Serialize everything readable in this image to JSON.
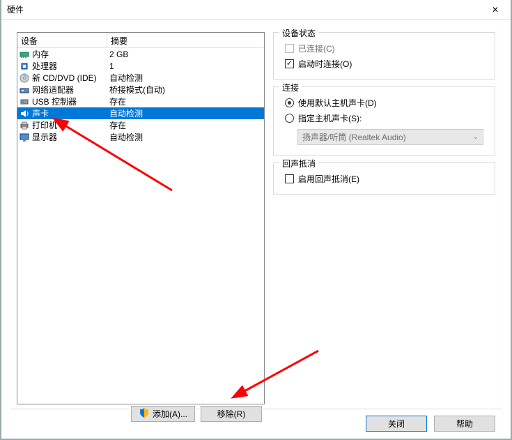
{
  "window": {
    "title": "硬件",
    "close": "✕"
  },
  "list": {
    "headers": {
      "device": "设备",
      "summary": "摘要"
    },
    "rows": [
      {
        "icon": "memory",
        "name": "内存",
        "summary": "2 GB"
      },
      {
        "icon": "cpu",
        "name": "处理器",
        "summary": "1"
      },
      {
        "icon": "cd",
        "name": "新 CD/DVD (IDE)",
        "summary": "自动检测"
      },
      {
        "icon": "net",
        "name": "网络适配器",
        "summary": "桥接模式(自动)"
      },
      {
        "icon": "usb",
        "name": "USB 控制器",
        "summary": "存在"
      },
      {
        "icon": "sound",
        "name": "声卡",
        "summary": "自动检测"
      },
      {
        "icon": "printer",
        "name": "打印机",
        "summary": "存在"
      },
      {
        "icon": "display",
        "name": "显示器",
        "summary": "自动检测"
      }
    ],
    "selected_index": 5
  },
  "buttons": {
    "add": "添加(A)...",
    "remove": "移除(R)"
  },
  "status": {
    "title": "设备状态",
    "connected": "已连接(C)",
    "autoconnect": "启动时连接(O)"
  },
  "connection": {
    "title": "连接",
    "default_host": "使用默认主机声卡(D)",
    "specify_host": "指定主机声卡(S):",
    "select_value": "扬声器/听筒 (Realtek Audio)"
  },
  "echo": {
    "title": "回声抵消",
    "enable": "启用回声抵消(E)"
  },
  "footer": {
    "close": "关闭",
    "help": "帮助"
  }
}
